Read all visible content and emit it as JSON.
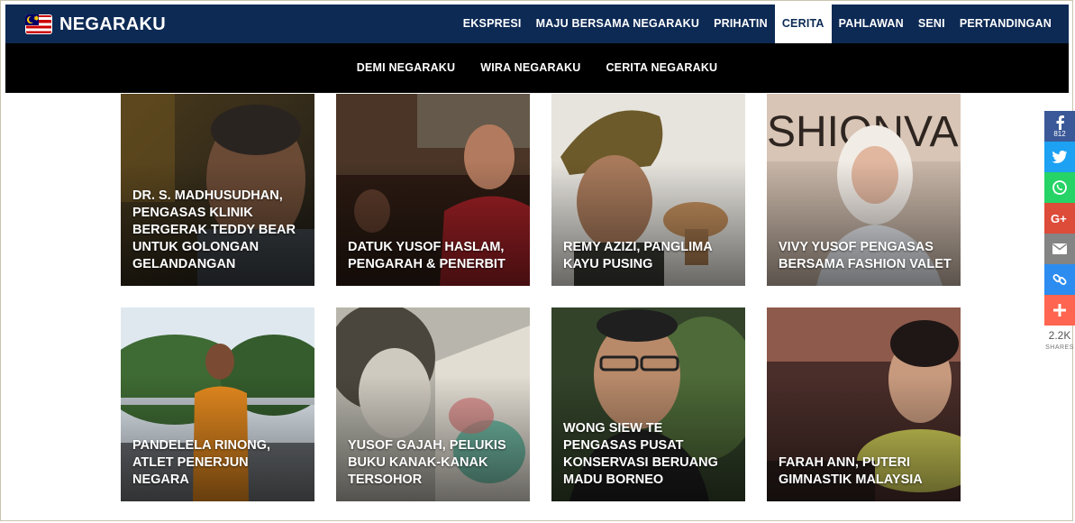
{
  "brand": {
    "name": "NEGARAKU"
  },
  "nav": {
    "items": [
      {
        "label": "EKSPRESI"
      },
      {
        "label": "MAJU BERSAMA NEGARAKU"
      },
      {
        "label": "PRIHATIN"
      },
      {
        "label": "CERITA",
        "active": true
      },
      {
        "label": "PAHLAWAN"
      },
      {
        "label": "SENI"
      },
      {
        "label": "PERTANDINGAN"
      }
    ]
  },
  "subnav": {
    "items": [
      {
        "label": "DEMI NEGARAKU"
      },
      {
        "label": "WIRA NEGARAKU"
      },
      {
        "label": "CERITA NEGARAKU"
      }
    ]
  },
  "cards": [
    {
      "title": "DR. S. MADHUSUDHAN, PENGASAS KLINIK BERGERAK TEDDY BEAR UNTUK GOLONGAN GELANDANGAN"
    },
    {
      "title": "DATUK YUSOF HASLAM, PENGARAH & PENERBIT"
    },
    {
      "title": "REMY AZIZI, PANGLIMA KAYU PUSING"
    },
    {
      "title": "VIVY YUSOF PENGASAS BERSAMA FASHION VALET"
    },
    {
      "title": "PANDELELA RINONG, ATLET PENERJUN NEGARA"
    },
    {
      "title": "YUSOF GAJAH, PELUKIS BUKU KANAK-KANAK TERSOHOR"
    },
    {
      "title": "WONG SIEW TE PENGASAS PUSAT KONSERVASI BERUANG MADU BORNEO"
    },
    {
      "title": "FARAH ANN, PUTERI GIMNASTIK MALAYSIA"
    }
  ],
  "share": {
    "facebook_count": "812",
    "total": "2.2K",
    "total_label": "SHARES",
    "buttons": [
      {
        "name": "facebook",
        "icon": "facebook-icon",
        "color": "#3b5998"
      },
      {
        "name": "twitter",
        "icon": "twitter-icon",
        "color": "#1da1f2"
      },
      {
        "name": "whatsapp",
        "icon": "whatsapp-icon",
        "color": "#25d366"
      },
      {
        "name": "google-plus",
        "icon": "google-plus-icon",
        "color": "#dd4b39"
      },
      {
        "name": "email",
        "icon": "email-icon",
        "color": "#848484"
      },
      {
        "name": "copy-link",
        "icon": "link-icon",
        "color": "#2d8cf0"
      },
      {
        "name": "more",
        "icon": "plus-icon",
        "color": "#ff6550"
      }
    ]
  },
  "colors": {
    "header": "#0d2a55",
    "subnav": "#000000",
    "background": "#ffffff"
  }
}
